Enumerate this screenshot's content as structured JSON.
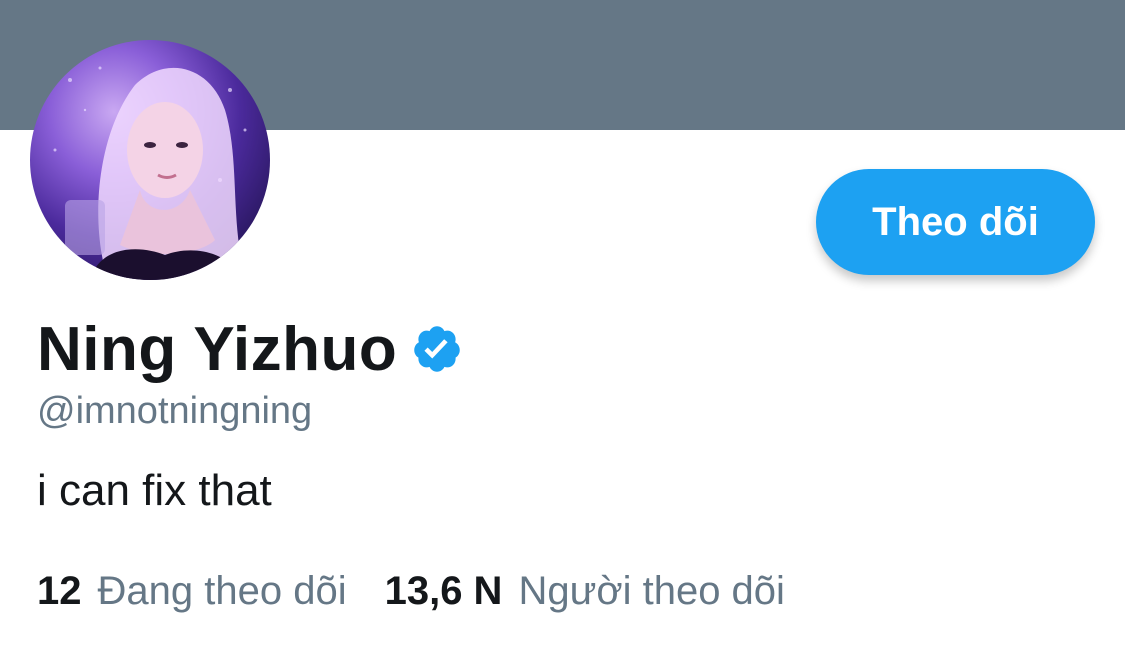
{
  "colors": {
    "banner": "#657786",
    "accent": "#1da1f2",
    "text_primary": "#14171a",
    "text_secondary": "#657786"
  },
  "profile": {
    "display_name": "Ning Yizhuo",
    "verified": true,
    "verified_icon": "verified-badge-icon",
    "handle": "@imnotningning",
    "bio": "i can fix that",
    "avatar_icon": "profile-photo"
  },
  "actions": {
    "follow_label": "Theo dõi"
  },
  "stats": {
    "following_count": "12",
    "following_label": "Đang theo dõi",
    "followers_count": "13,6 N",
    "followers_label": "Người theo dõi"
  }
}
